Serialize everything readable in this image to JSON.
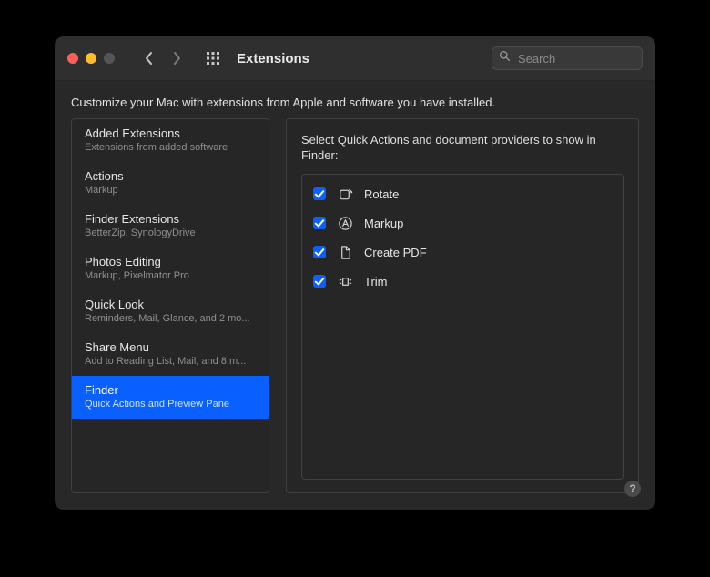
{
  "window": {
    "title": "Extensions",
    "search_placeholder": "Search"
  },
  "subtitle": "Customize your Mac with extensions from Apple and software you have installed.",
  "sidebar": [
    {
      "title": "Added Extensions",
      "sub": "Extensions from added software",
      "selected": false
    },
    {
      "title": "Actions",
      "sub": "Markup",
      "selected": false
    },
    {
      "title": "Finder Extensions",
      "sub": "BetterZip, SynologyDrive",
      "selected": false
    },
    {
      "title": "Photos Editing",
      "sub": "Markup, Pixelmator Pro",
      "selected": false
    },
    {
      "title": "Quick Look",
      "sub": "Reminders, Mail, Glance, and 2 mo...",
      "selected": false
    },
    {
      "title": "Share Menu",
      "sub": "Add to Reading List, Mail, and 8 m...",
      "selected": false
    },
    {
      "title": "Finder",
      "sub": "Quick Actions and Preview Pane",
      "selected": true
    }
  ],
  "detail": {
    "heading": "Select Quick Actions and document providers to show in Finder:",
    "actions": [
      {
        "label": "Rotate",
        "checked": true,
        "icon": "rotate"
      },
      {
        "label": "Markup",
        "checked": true,
        "icon": "markup"
      },
      {
        "label": "Create PDF",
        "checked": true,
        "icon": "document"
      },
      {
        "label": "Trim",
        "checked": true,
        "icon": "trim"
      }
    ]
  },
  "help_label": "?"
}
